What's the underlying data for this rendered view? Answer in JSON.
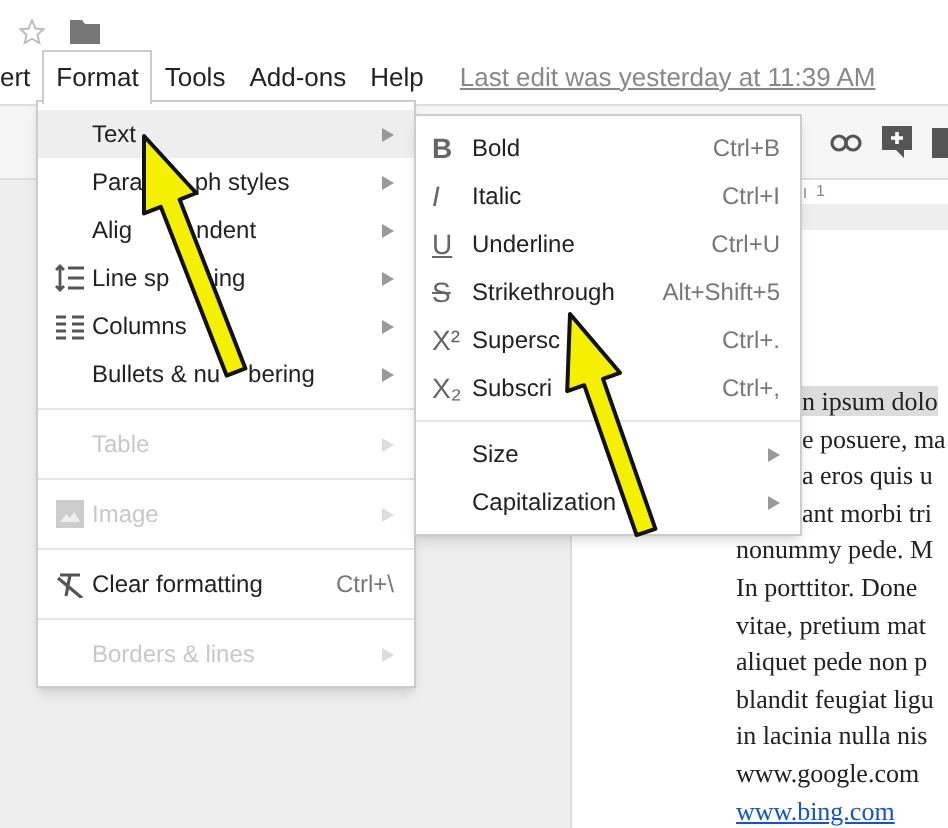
{
  "menu_bar": [
    {
      "label": "ert",
      "selected": false
    },
    {
      "label": "Format",
      "selected": true
    },
    {
      "label": "Tools",
      "selected": false
    },
    {
      "label": "Add-ons",
      "selected": false
    },
    {
      "label": "Help",
      "selected": false
    }
  ],
  "last_edit": "Last edit was yesterday at 11:39 AM",
  "ruler": {
    "mark": "1"
  },
  "format_menu": [
    {
      "kind": "item",
      "label_parts": [
        "Text"
      ],
      "submenu": true,
      "disabled": false,
      "selected": true
    },
    {
      "kind": "item",
      "label_parts": [
        "Para",
        "ph styles"
      ],
      "submenu": true,
      "disabled": false,
      "selected": false
    },
    {
      "kind": "item",
      "label_parts": [
        "Alig",
        "ndent"
      ],
      "submenu": true,
      "disabled": false,
      "selected": false
    },
    {
      "kind": "item",
      "label_parts": [
        "Line sp",
        "ing"
      ],
      "submenu": true,
      "disabled": false,
      "selected": false
    },
    {
      "kind": "item",
      "label_parts": [
        "Columns"
      ],
      "submenu": true,
      "disabled": false,
      "selected": false
    },
    {
      "kind": "item",
      "label_parts": [
        "Bullets & nu",
        "bering"
      ],
      "submenu": true,
      "disabled": false,
      "selected": false
    },
    {
      "kind": "divider"
    },
    {
      "kind": "item",
      "label_parts": [
        "Table"
      ],
      "submenu": true,
      "disabled": true,
      "selected": false
    },
    {
      "kind": "divider"
    },
    {
      "kind": "item",
      "label_parts": [
        "Image"
      ],
      "submenu": true,
      "disabled": true,
      "selected": false
    },
    {
      "kind": "divider"
    },
    {
      "kind": "item",
      "label_parts": [
        "Clear formatting"
      ],
      "shortcut": "Ctrl+\\",
      "submenu": false,
      "disabled": false,
      "selected": false
    },
    {
      "kind": "divider"
    },
    {
      "kind": "item",
      "label_parts": [
        "Borders & lines"
      ],
      "submenu": true,
      "disabled": true,
      "selected": false
    }
  ],
  "text_submenu": [
    {
      "kind": "item",
      "glyph": "B",
      "label": "Bold",
      "shortcut": "Ctrl+B",
      "submenu": false
    },
    {
      "kind": "item",
      "glyph": "I",
      "label": "Italic",
      "shortcut": "Ctrl+I",
      "submenu": false
    },
    {
      "kind": "item",
      "glyph": "U",
      "label": "Underline",
      "shortcut": "Ctrl+U",
      "submenu": false
    },
    {
      "kind": "item",
      "glyph": "S",
      "label": "Strikethrough",
      "shortcut": "Alt+Shift+5",
      "submenu": false
    },
    {
      "kind": "item",
      "glyph": "X²",
      "label": "Supersc",
      "shortcut": "Ctrl+.",
      "submenu": false
    },
    {
      "kind": "item",
      "glyph": "X₂",
      "label": "Subscri",
      "shortcut": "Ctrl+,",
      "submenu": false
    },
    {
      "kind": "divider"
    },
    {
      "kind": "item",
      "label": "Size",
      "submenu": true
    },
    {
      "kind": "item",
      "label": "Capitalization",
      "submenu": true
    }
  ],
  "document": {
    "lines": [
      {
        "text": "n ipsum dolo",
        "highlighted": true
      },
      {
        "text": "e posuere, ma",
        "highlighted": false
      },
      {
        "text": "a eros quis u",
        "highlighted": false
      },
      {
        "text": "ant morbi tri",
        "highlighted": false
      },
      {
        "text": "nonummy pede. M",
        "highlighted": false
      },
      {
        "text": "In porttitor. Done",
        "highlighted": false
      },
      {
        "text": "vitae, pretium mat",
        "highlighted": false
      },
      {
        "text": "aliquet pede non p",
        "highlighted": false
      },
      {
        "text": "blandit feugiat ligu",
        "highlighted": false
      },
      {
        "text": "in lacinia nulla nis",
        "highlighted": false
      },
      {
        "text": "www.google.com",
        "highlighted": false
      },
      {
        "text": "www.bing.com",
        "highlighted": false,
        "link": true
      }
    ]
  }
}
